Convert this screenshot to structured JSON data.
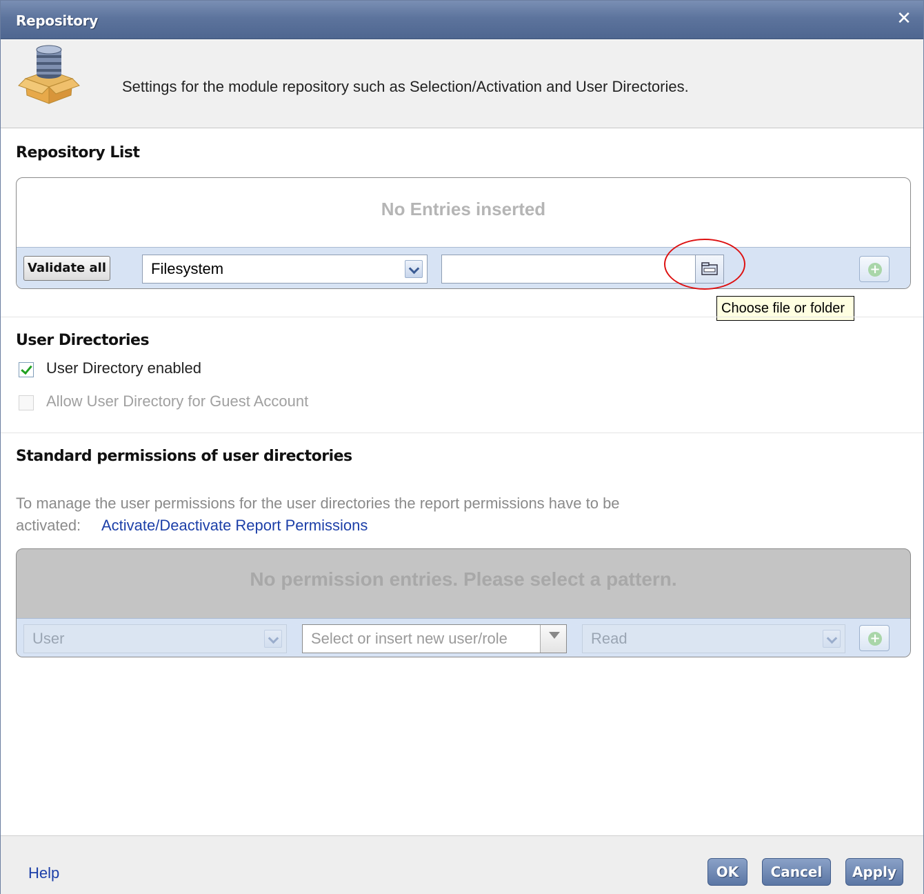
{
  "window": {
    "title": "Repository",
    "close_icon": "close-icon"
  },
  "header": {
    "description": "Settings for the module repository such as Selection/Activation and User Directories.",
    "icon": "repository-box-icon"
  },
  "repository_list": {
    "title": "Repository List",
    "empty_text": "No Entries inserted",
    "validate_button": "Validate all",
    "type_select": {
      "value": "Filesystem"
    },
    "path_input": {
      "value": "",
      "placeholder": ""
    },
    "browse_icon": "folder-icon",
    "add_icon": "add-icon",
    "tooltip": "Choose file or folder"
  },
  "user_directories": {
    "title": "User Directories",
    "enabled": {
      "label": "User Directory enabled",
      "checked": true
    },
    "guest": {
      "label": "Allow User Directory for Guest Account",
      "checked": false,
      "disabled": true
    }
  },
  "permissions": {
    "title": "Standard permissions of user directories",
    "info_line1": "To manage the user permissions for the user directories the report permissions have to be",
    "info_prefix": "activated:",
    "link": "Activate/Deactivate Report Permissions",
    "empty_text": "No permission entries. Please select a pattern.",
    "type_select": {
      "value": "User"
    },
    "user_select": {
      "placeholder": "Select or insert new user/role"
    },
    "permission_select": {
      "value": "Read"
    }
  },
  "footer": {
    "help": "Help",
    "ok": "OK",
    "cancel": "Cancel",
    "apply": "Apply"
  },
  "colors": {
    "titlebar": "#5d749d",
    "toolbar": "#d7e3f4",
    "link": "#1c3fa8",
    "highlight": "#dd1111"
  }
}
